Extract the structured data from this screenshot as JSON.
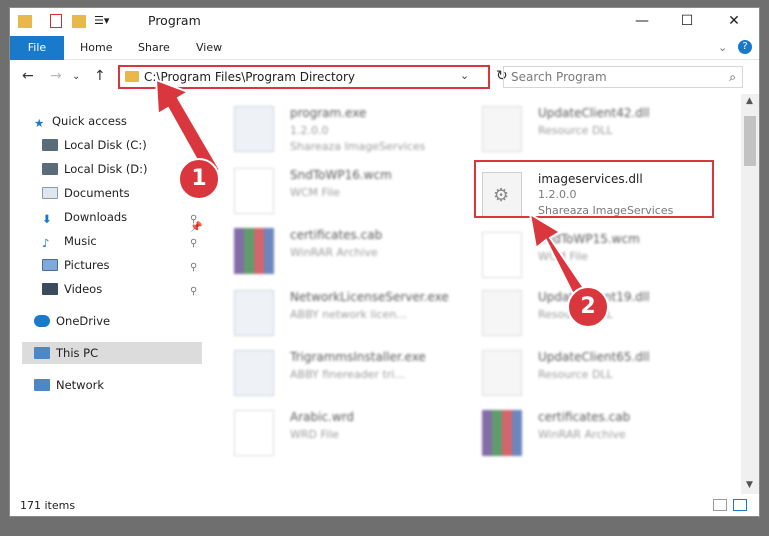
{
  "window": {
    "title": "Program"
  },
  "ribbon": {
    "file": "File",
    "home": "Home",
    "share": "Share",
    "view": "View"
  },
  "address": {
    "path": "C:\\Program Files\\Program Directory"
  },
  "search": {
    "placeholder": "Search Program"
  },
  "nav": {
    "quick_access": "Quick access",
    "local_c": "Local Disk (C:)",
    "local_d": "Local Disk (D:)",
    "documents": "Documents",
    "downloads": "Downloads",
    "music": "Music",
    "pictures": "Pictures",
    "videos": "Videos",
    "onedrive": "OneDrive",
    "this_pc": "This PC",
    "network": "Network"
  },
  "files": {
    "f1": {
      "name": "program.exe",
      "line1": "1.2.0.0",
      "line2": "Shareaza ImageServices"
    },
    "f2": {
      "name": "UpdateClient42.dll",
      "line1": "Resource DLL"
    },
    "f3": {
      "name": "SndToWP16.wcm",
      "line1": "WCM File"
    },
    "f4": {
      "name": "imageservices.dll",
      "line1": "1.2.0.0",
      "line2": "Shareaza ImageServices"
    },
    "f5": {
      "name": "certificates.cab",
      "line1": "WinRAR Archive"
    },
    "f6": {
      "name": "SndToWP15.wcm",
      "line1": "WCM File"
    },
    "f7": {
      "name": "NetworkLicenseServer.exe",
      "line1": "ABBY network licen..."
    },
    "f8": {
      "name": "UpdateClient19.dll",
      "line1": "Resource DLL"
    },
    "f9": {
      "name": "TrigrammsInstaller.exe",
      "line1": "ABBY finereader tri..."
    },
    "f10": {
      "name": "UpdateClient65.dll",
      "line1": "Resource DLL"
    },
    "f11": {
      "name": "Arabic.wrd",
      "line1": "WRD File"
    },
    "f12": {
      "name": "certificates.cab",
      "line1": "WinRAR Archive"
    }
  },
  "status": {
    "count": "171 items"
  },
  "callouts": {
    "one": "1",
    "two": "2"
  },
  "colors": {
    "accent": "#1979ca",
    "annotation": "#d9363e",
    "folder": "#e8b84a"
  }
}
